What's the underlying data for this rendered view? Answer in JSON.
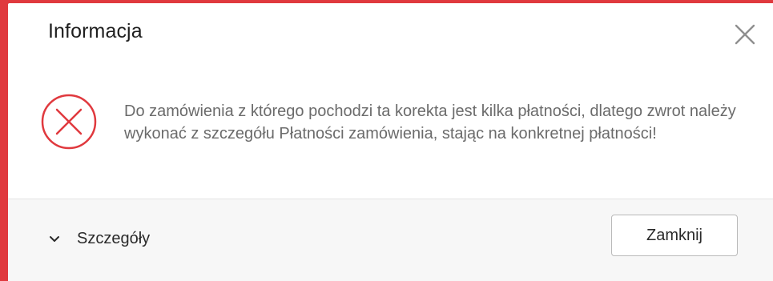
{
  "dialog": {
    "title": "Informacja",
    "message": "Do zamówienia z którego pochodzi ta korekta jest kilka płatności, dlatego zwrot należy wykonać z szczegółu Płatności zamówienia, stając na konkretnej płatności!",
    "details_label": "Szczegóły",
    "close_button_label": "Zamknij",
    "icons": {
      "close": "close-icon",
      "error": "error-circle-x-icon",
      "expand": "chevron-down-icon"
    },
    "colors": {
      "accent": "#e0393e",
      "error_icon": "#e0393e",
      "text_primary": "#1f1f1f",
      "text_message": "#6b6b6b"
    }
  }
}
